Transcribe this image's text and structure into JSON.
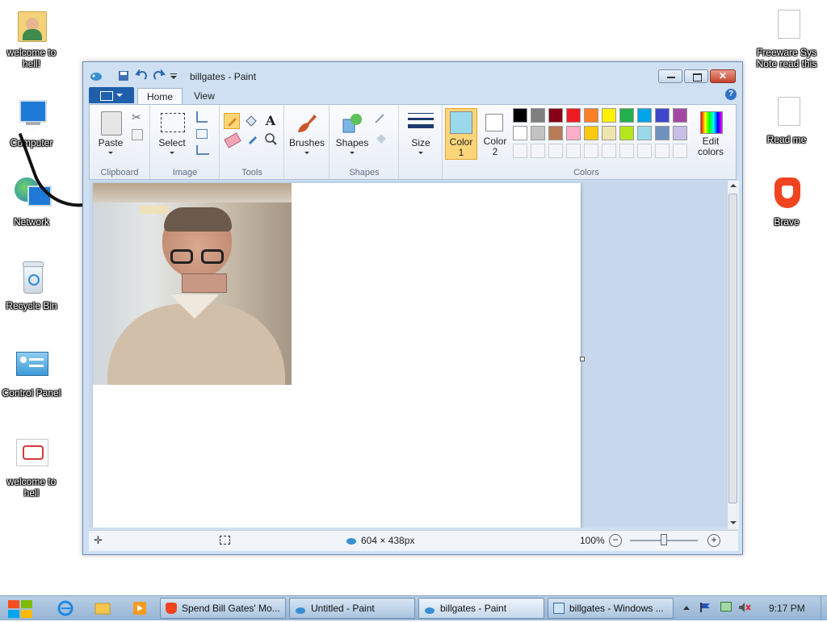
{
  "desktop": {
    "left_icons": [
      {
        "label": "welcome to\nhell!"
      },
      {
        "label": "Computer"
      },
      {
        "label": "Network"
      },
      {
        "label": "Recycle Bin"
      },
      {
        "label": "Control Panel"
      },
      {
        "label": "welcome to\nhell"
      }
    ],
    "right_icons": [
      {
        "label": "Freeware Sys\nNote read this"
      },
      {
        "label": "Read me"
      },
      {
        "label": "Brave"
      }
    ]
  },
  "window": {
    "title": "billgates - Paint",
    "tabs": [
      "Home",
      "View"
    ],
    "ribbon": {
      "clipboard": {
        "paste": "Paste",
        "group": "Clipboard"
      },
      "image": {
        "select": "Select",
        "group": "Image"
      },
      "tools": {
        "group": "Tools"
      },
      "brushes": {
        "label": "Brushes"
      },
      "shapes": {
        "label": "Shapes",
        "group": "Shapes"
      },
      "size": {
        "label": "Size"
      },
      "colors": {
        "color1_label": "Color\n1",
        "color2_label": "Color\n2",
        "edit_label": "Edit\ncolors",
        "group": "Colors",
        "color1": "#99d9ea",
        "color2": "#ffffff",
        "palette_row1": [
          "#000000",
          "#7f7f7f",
          "#880015",
          "#ed1c24",
          "#ff7f27",
          "#fff200",
          "#22b14c",
          "#00a2e8",
          "#3f48cc",
          "#a349a4"
        ],
        "palette_row2": [
          "#ffffff",
          "#c3c3c3",
          "#b97a57",
          "#ffaec9",
          "#ffc90e",
          "#efe4b0",
          "#b5e61d",
          "#99d9ea",
          "#7092be",
          "#c8bfe7"
        ]
      }
    },
    "status": {
      "dimensions": "604 × 438px",
      "zoom": "100%"
    }
  },
  "taskbar": {
    "buttons": [
      {
        "label": "Spend Bill Gates' Mo..."
      },
      {
        "label": "Untitled - Paint"
      },
      {
        "label": "billgates - Paint"
      },
      {
        "label": "billgates - Windows ..."
      }
    ],
    "clock": "9:17 PM"
  }
}
